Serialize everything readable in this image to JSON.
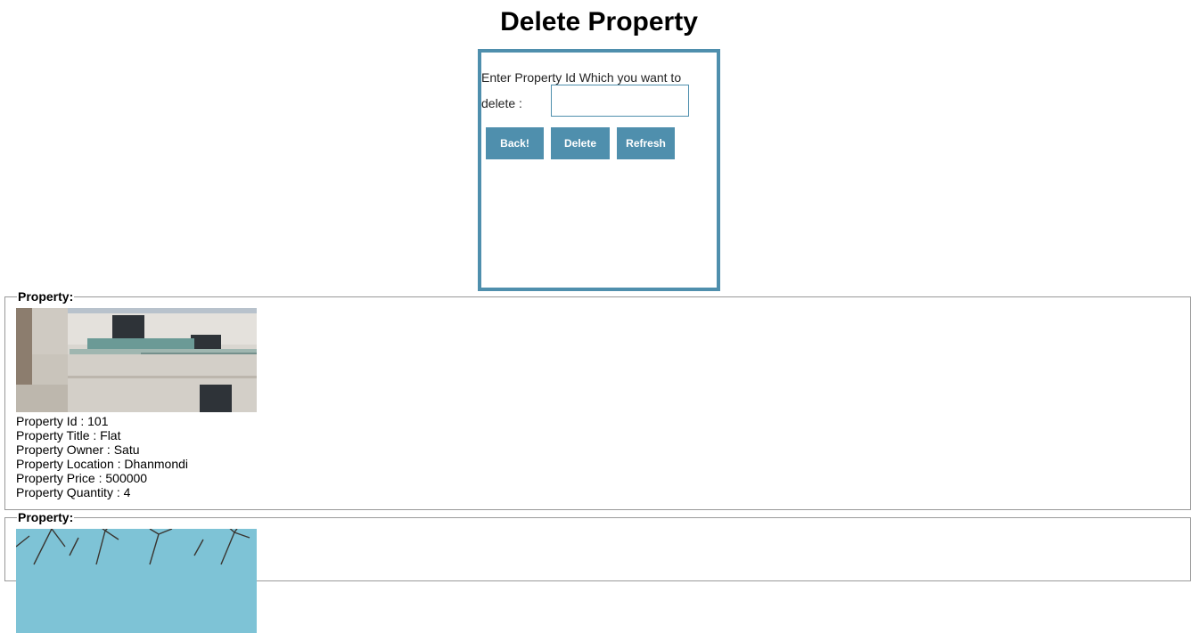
{
  "page": {
    "title": "Delete Property"
  },
  "form": {
    "prompt_line1": "Enter Property Id Which you want to",
    "prompt_line2": "delete :",
    "input_value": "",
    "input_placeholder": "",
    "accent_color": "#4f8fad",
    "buttons": {
      "back": "Back!",
      "delete": "Delete",
      "refresh": "Refresh"
    }
  },
  "properties": [
    {
      "legend": "Property:",
      "image": "building-photo",
      "lines": [
        "Property Id : 101",
        "Property Title : Flat",
        "Property Owner : Satu",
        "Property Location : Dhanmondi",
        "Property Price : 500000",
        "Property Quantity : 4"
      ]
    },
    {
      "legend": "Property:",
      "image": "trees-sky-photo",
      "lines": []
    }
  ]
}
